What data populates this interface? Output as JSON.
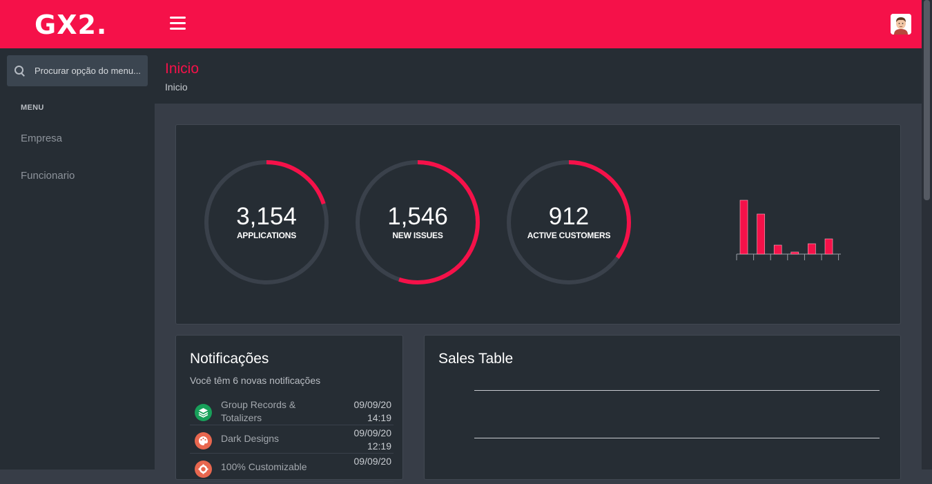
{
  "header": {
    "logo_text": "GX2.",
    "accent_color": "#f51149",
    "menu_icon": "hamburger-icon",
    "avatar_icon": "user-avatar-icon"
  },
  "sidebar": {
    "search_placeholder": "Procurar opção do menu...",
    "menu_header": "MENU",
    "items": [
      {
        "label": "Empresa"
      },
      {
        "label": "Funcionario"
      }
    ]
  },
  "page": {
    "title": "Inicio",
    "breadcrumb": "Inicio"
  },
  "stats": [
    {
      "value": "3,154",
      "label": "APPLICATIONS",
      "progress": 0.2
    },
    {
      "value": "1,546",
      "label": "NEW ISSUES",
      "progress": 0.55
    },
    {
      "value": "912",
      "label": "ACTIVE CUSTOMERS",
      "progress": 0.35
    }
  ],
  "chart_data": {
    "type": "bar",
    "values": [
      78,
      58,
      13,
      3,
      15,
      22
    ],
    "ylim": [
      0,
      80
    ],
    "color": "#f51149"
  },
  "notifications": {
    "title": "Notificações",
    "subtitle": "Você têm 6 novas notificações",
    "items": [
      {
        "text": "Group Records & Totalizers",
        "date": "09/09/20",
        "time": "14:19",
        "icon": "layers-icon",
        "color": "#18a05a"
      },
      {
        "text": "Dark Designs",
        "date": "09/09/20",
        "time": "12:19",
        "icon": "palette-icon",
        "color": "#e8674f"
      },
      {
        "text": "100% Customizable",
        "date": "09/09/20",
        "time": "",
        "icon": "gear-icon",
        "color": "#e8674f"
      }
    ]
  },
  "sales": {
    "title": "Sales Table"
  }
}
